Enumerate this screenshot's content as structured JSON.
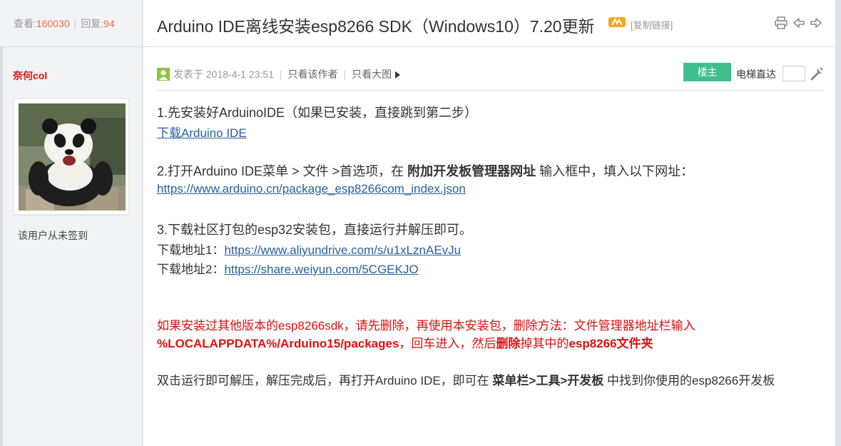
{
  "header": {
    "views_label": "查看:",
    "views": "160030",
    "separator": "|",
    "replies_label": "回复:",
    "replies": "94",
    "title": "Arduino IDE离线安装esp8266 SDK（Windows10）7.20更新",
    "copy_link": "[复制链接]"
  },
  "user": {
    "name": "奈何col",
    "signin_status": "该用户从未签到"
  },
  "post_meta": {
    "posted_prefix": "发表于",
    "posted_at": "2018-4-1 23:51",
    "only_author": "只看该作者",
    "only_large_image": "只看大图",
    "floor_badge": "楼主",
    "elevator_label": "电梯直达",
    "pipe": "|"
  },
  "content": {
    "step1": "1.先安装好ArduinoIDE（如果已安装，直接跳到第二步）",
    "step1_link": "下载Arduino IDE",
    "step2_a": "2.打开Arduino IDE菜单 > 文件 >首选项，在 ",
    "step2_bold": "附加开发板管理器网址",
    "step2_b": " 输入框中，填入以下网址：",
    "step2_link": "https://www.arduino.cn/package_esp8266com_index.json",
    "step3": "3.下载社区打包的esp32安装包，直接运行并解压即可。",
    "dl1_label": "下载地址1：",
    "dl1_link": "https://www.aliyundrive.com/s/u1xLznAEvJu",
    "dl2_label": "下载地址2：",
    "dl2_link": "https://share.weiyun.com/5CGEKJO",
    "warn_line1": "如果安装过其他版本的esp8266sdk，请先删除，再使用本安装包，删除方法：文件管理器地址栏输入",
    "warn_path": "%LOCALAPPDATA%/Arduino15/packages",
    "warn_mid": "，回车进入，然后",
    "warn_delete": "删除",
    "warn_mid2": "掉其中的",
    "warn_folder": "esp8266文件夹",
    "final_a": "双击运行即可解压，解压完成后，再打开Arduino IDE，即可在 ",
    "final_bold": "菜单栏>工具>开发板",
    "final_b": " 中找到你使用的esp8266开发板"
  },
  "icons": {
    "hot": "hot-badge-icon",
    "print": "print-icon",
    "prev": "prev-thread-icon",
    "next": "next-thread-icon",
    "poster": "poster-icon",
    "tools": "wrench-icon"
  },
  "colors": {
    "accent_red": "#e01515",
    "number_orange": "#f26c4f",
    "link_blue": "#2a5f9e",
    "badge_green": "#3fbf8f"
  }
}
